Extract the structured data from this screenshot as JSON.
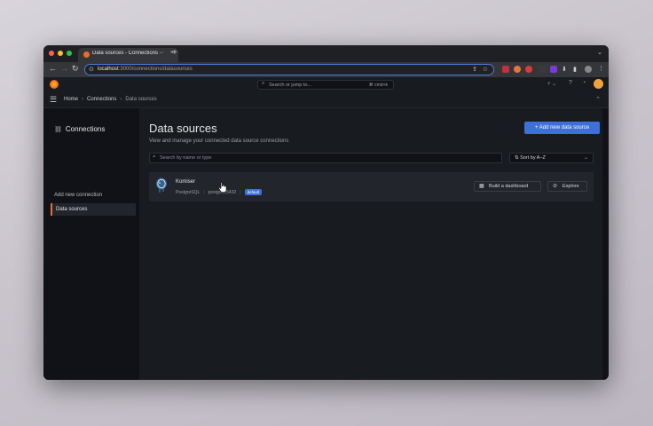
{
  "browser": {
    "tab_title": "Data sources - Connections - Grafana",
    "tab_close": "×",
    "new_tab": "+",
    "tab_menu": "⌄",
    "url_host": "localhost",
    "url_path": ":3000/connections/datasources",
    "nav_back": "←",
    "nav_forward": "→",
    "nav_reload": "↻"
  },
  "topbar": {
    "search_placeholder": "Search or jump to...",
    "search_shortcut": "⌘ cmd+k",
    "plus_label": "+ ⌄"
  },
  "breadcrumb": {
    "home": "Home",
    "connections": "Connections",
    "current": "Data sources",
    "separator": "›"
  },
  "sidebar": {
    "title": "Connections",
    "items": [
      {
        "label": "Add new connection"
      },
      {
        "label": "Data sources"
      }
    ]
  },
  "main": {
    "title": "Data sources",
    "subtitle": "View and manage your connected data source connections",
    "add_button": "+ Add new data source",
    "search_placeholder": "Search by name or type",
    "sort_label": "Sort by A–Z",
    "datasource": {
      "name": "Komiser",
      "type": "PostgreSQL",
      "host": "postgres:5432",
      "badge": "default",
      "build_dashboard": "Build a dashboard",
      "explore": "Explore"
    }
  },
  "colors": {
    "accent": "#3d71d9",
    "active_marker": "#f46b1f",
    "background": "#111217",
    "panel": "#181b1f"
  }
}
